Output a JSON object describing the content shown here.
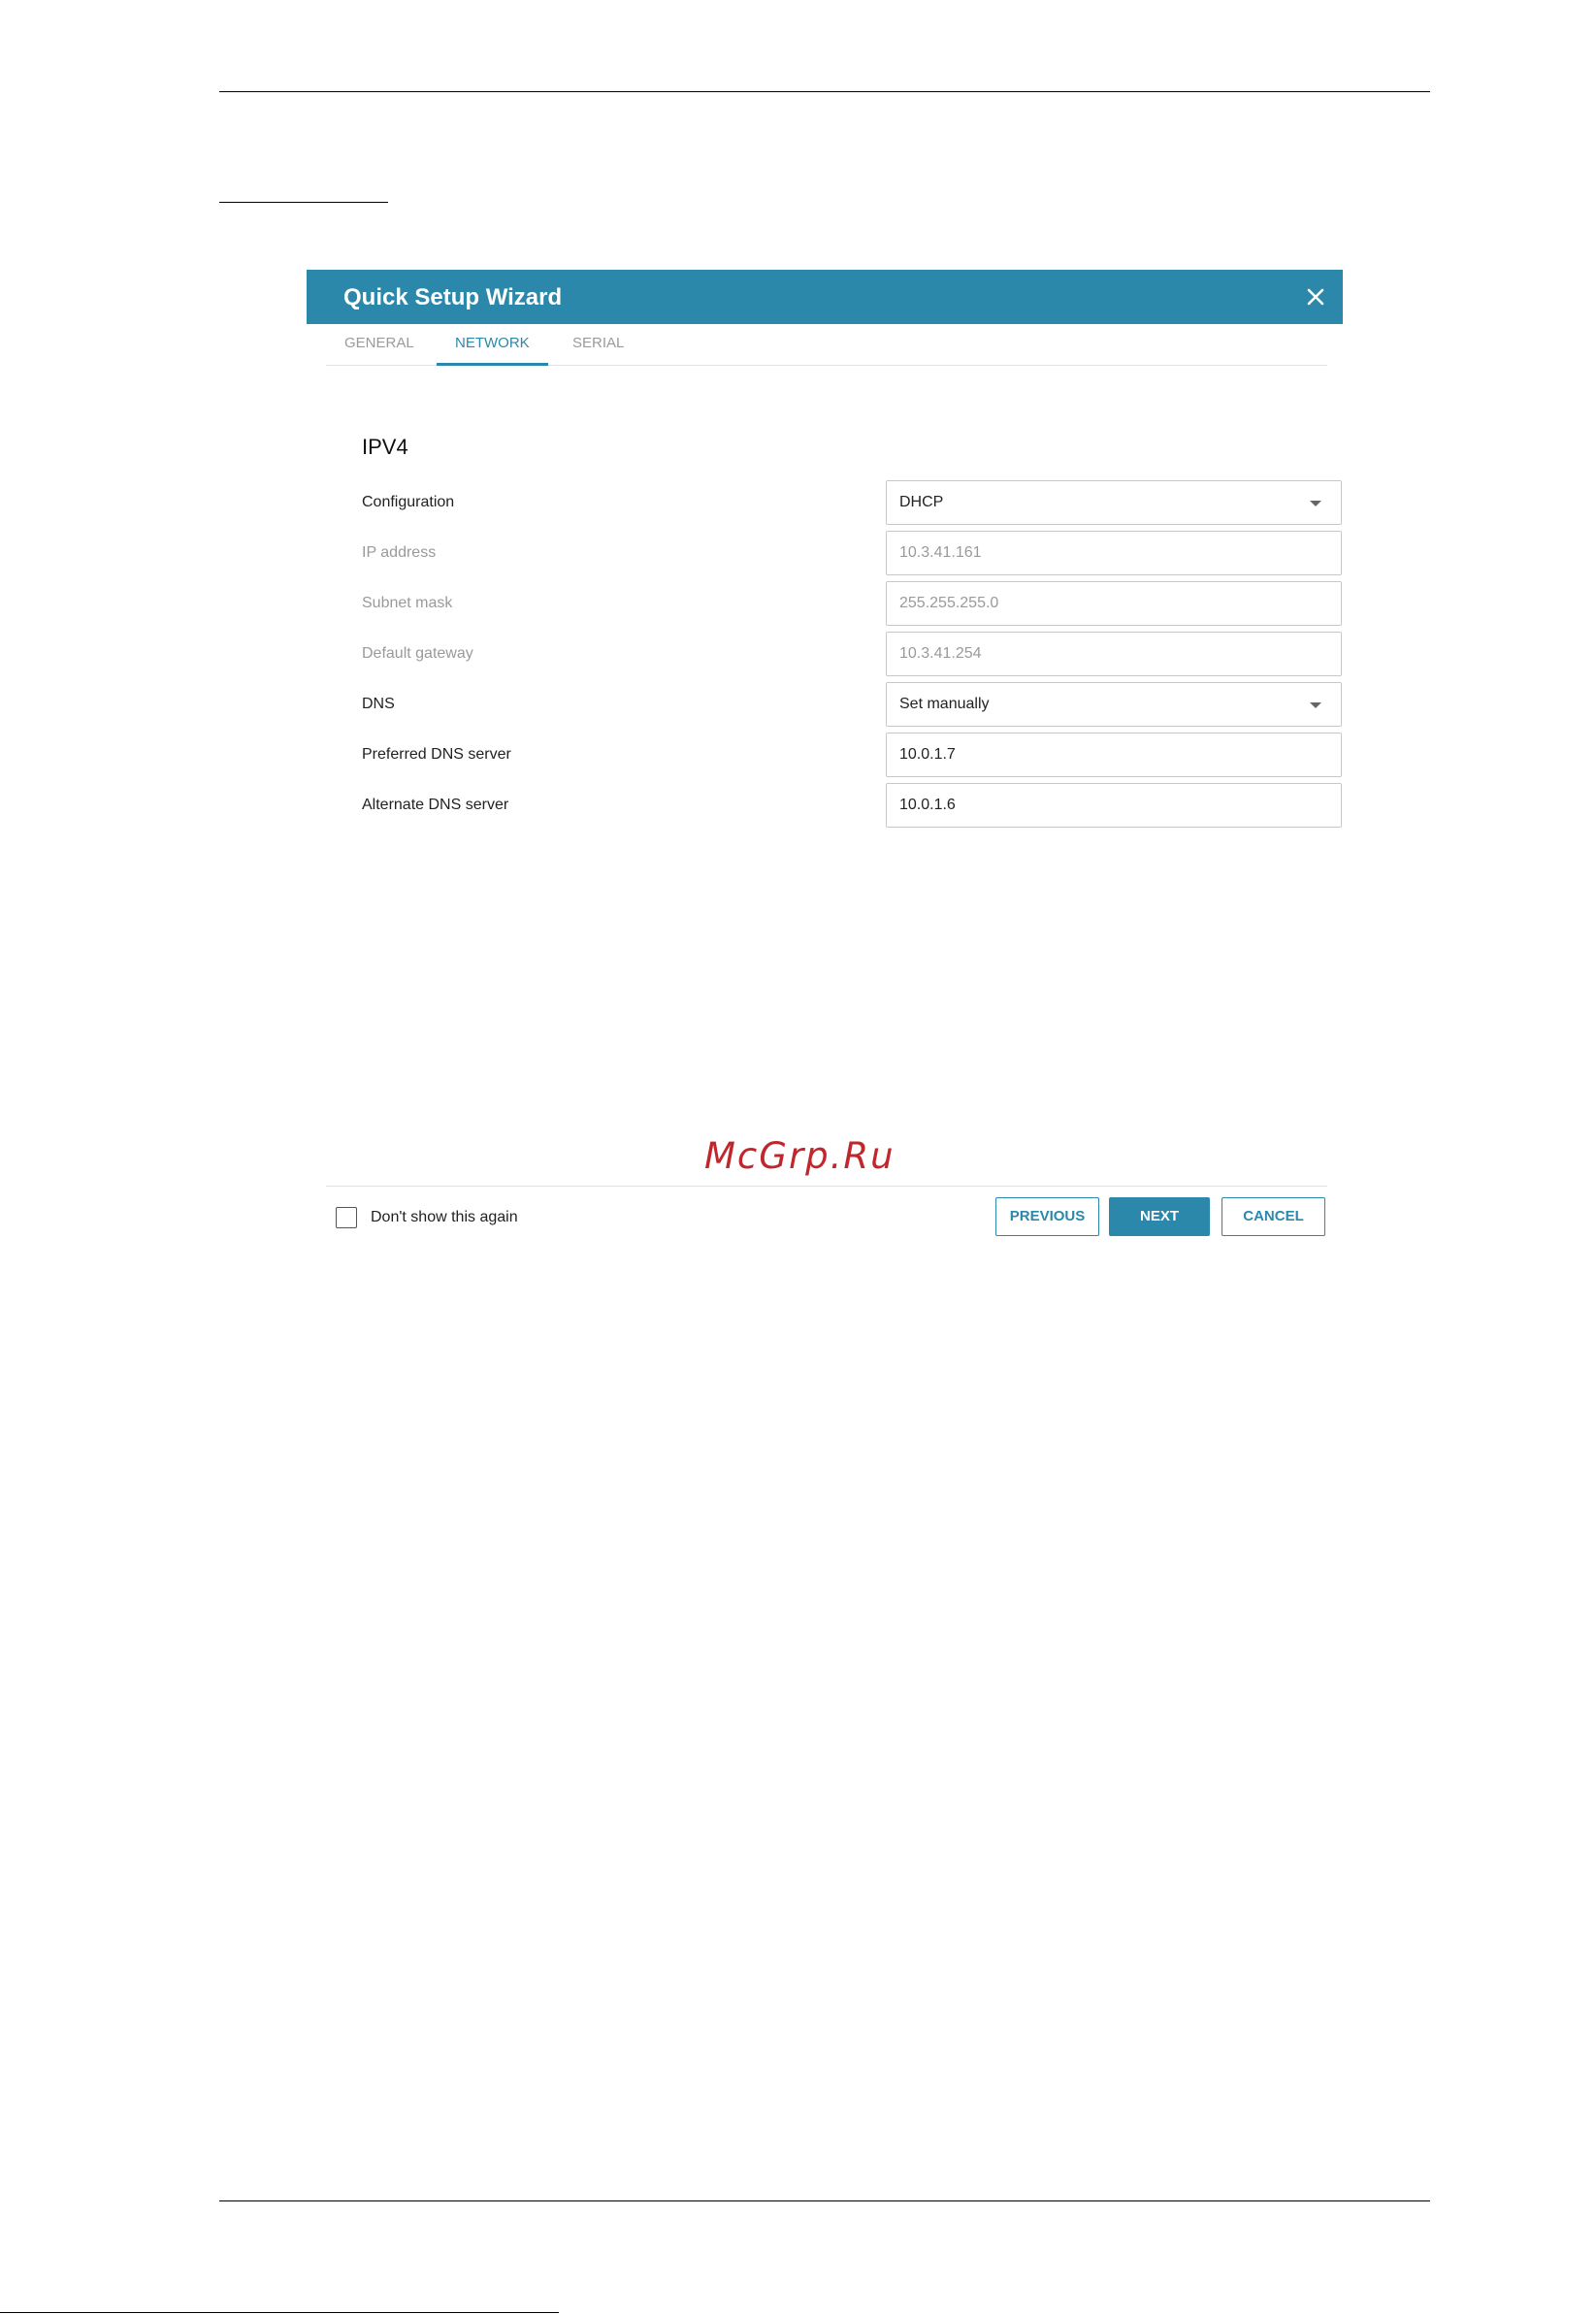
{
  "wizard": {
    "title": "Quick Setup Wizard",
    "tabs": [
      {
        "label": "GENERAL",
        "active": false
      },
      {
        "label": "NETWORK",
        "active": true
      },
      {
        "label": "SERIAL",
        "active": false
      }
    ],
    "section_title": "IPV4",
    "fields": [
      {
        "label": "Configuration",
        "value": "DHCP",
        "type": "select",
        "disabled": false
      },
      {
        "label": "IP address",
        "value": "10.3.41.161",
        "type": "text",
        "disabled": true
      },
      {
        "label": "Subnet mask",
        "value": "255.255.255.0",
        "type": "text",
        "disabled": true
      },
      {
        "label": "Default gateway",
        "value": "10.3.41.254",
        "type": "text",
        "disabled": true
      },
      {
        "label": "DNS",
        "value": "Set manually",
        "type": "select",
        "disabled": false
      },
      {
        "label": "Preferred DNS server",
        "value": "10.0.1.7",
        "type": "text",
        "disabled": false
      },
      {
        "label": "Alternate DNS server",
        "value": "10.0.1.6",
        "type": "text",
        "disabled": false
      }
    ],
    "dont_show_label": "Don't show this again",
    "buttons": {
      "previous": "PREVIOUS",
      "next": "NEXT",
      "cancel": "CANCEL"
    }
  },
  "watermark": "McGrp.Ru",
  "colors": {
    "accent": "#2c88aa",
    "watermark": "#c0272d",
    "disabled_text": "#9a9a9a"
  },
  "icons": {
    "close": "close-icon",
    "dropdown": "chevron-down-icon",
    "checkbox": "checkbox-icon"
  }
}
